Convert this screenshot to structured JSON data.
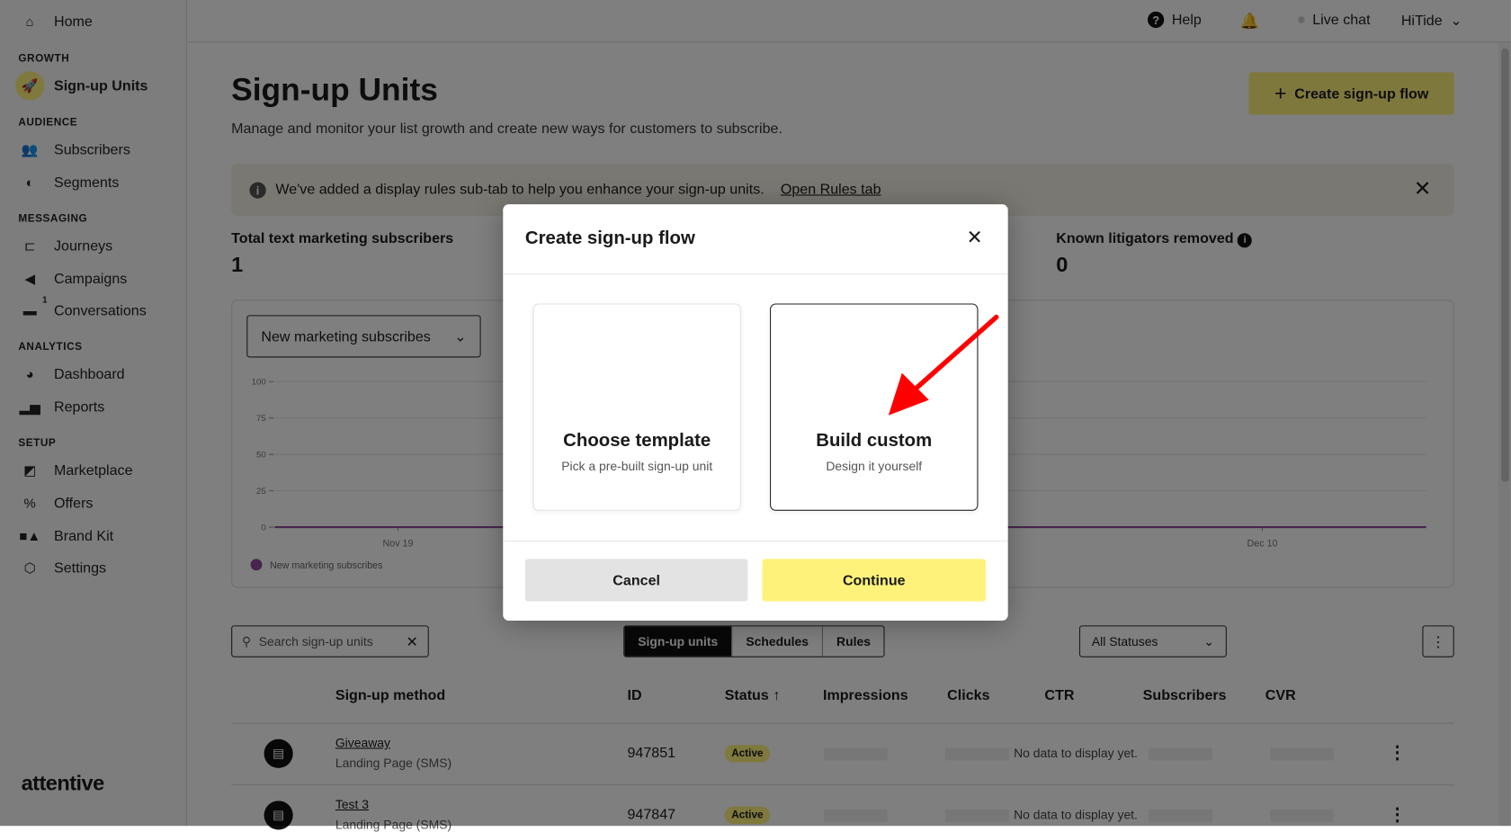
{
  "sidebar": {
    "home": "Home",
    "sections": [
      {
        "title": "GROWTH",
        "items": [
          {
            "label": "Sign-up Units",
            "icon": "rocket-icon",
            "active": true
          }
        ]
      },
      {
        "title": "AUDIENCE",
        "items": [
          {
            "label": "Subscribers",
            "icon": "users-icon"
          },
          {
            "label": "Segments",
            "icon": "segments-icon"
          }
        ]
      },
      {
        "title": "MESSAGING",
        "items": [
          {
            "label": "Journeys",
            "icon": "journeys-icon"
          },
          {
            "label": "Campaigns",
            "icon": "megaphone-icon"
          },
          {
            "label": "Conversations",
            "icon": "chat-icon",
            "badge": "1"
          }
        ]
      },
      {
        "title": "ANALYTICS",
        "items": [
          {
            "label": "Dashboard",
            "icon": "pie-chart-icon"
          },
          {
            "label": "Reports",
            "icon": "bar-chart-icon"
          }
        ]
      },
      {
        "title": "SETUP",
        "items": [
          {
            "label": "Marketplace",
            "icon": "marketplace-icon"
          },
          {
            "label": "Offers",
            "icon": "percent-icon"
          },
          {
            "label": "Brand Kit",
            "icon": "shapes-icon"
          },
          {
            "label": "Settings",
            "icon": "gear-icon"
          }
        ]
      }
    ],
    "logo": "attentive"
  },
  "header": {
    "help": "Help",
    "live_chat": "Live chat",
    "account": "HiTide"
  },
  "page": {
    "title": "Sign-up Units",
    "subtitle": "Manage and monitor your list growth and create new ways for customers to subscribe.",
    "create_button": "Create sign-up flow",
    "banner": {
      "text": "We've added a display rules sub-tab to help you enhance your sign-up units.",
      "link": "Open Rules tab"
    },
    "stats": [
      {
        "label": "Total text marketing subscribers",
        "value": "1"
      },
      {
        "label": "Known litigators removed",
        "value": "0"
      }
    ],
    "metric_select": "New marketing subscribes"
  },
  "chart_data": {
    "type": "line",
    "y_ticks": [
      "0",
      "25",
      "50",
      "75",
      "100"
    ],
    "ylim": [
      0,
      100
    ],
    "x_ticks": [
      "Nov 19",
      "Dec 10"
    ],
    "series": [
      {
        "name": "New marketing subscribes",
        "values": [
          0,
          0,
          0,
          0,
          0,
          0,
          0,
          0,
          0,
          0,
          0,
          0,
          0,
          0,
          0,
          0,
          0,
          0,
          0,
          0,
          0,
          0,
          0,
          0,
          0,
          0,
          0,
          0,
          0,
          0
        ],
        "color": "#8e4b9c"
      }
    ],
    "grid": true,
    "legend": "bottom-left"
  },
  "toolbar": {
    "search_placeholder": "Search sign-up units",
    "tabs": [
      "Sign-up units",
      "Schedules",
      "Rules"
    ],
    "active_tab": "Sign-up units",
    "status_filter": "All Statuses"
  },
  "table": {
    "columns": [
      "Sign-up method",
      "ID",
      "Status",
      "Impressions",
      "Clicks",
      "CTR",
      "Subscribers",
      "CVR"
    ],
    "sorted_column": "Status",
    "rows": [
      {
        "name": "Giveaway",
        "type": "Landing Page (SMS)",
        "id": "947851",
        "status": "Active",
        "note": "No data to display yet."
      },
      {
        "name": "Test 3",
        "type": "Landing Page (SMS)",
        "id": "947847",
        "status": "Active",
        "note": "No data to display yet."
      }
    ]
  },
  "modal": {
    "title": "Create sign-up flow",
    "options": [
      {
        "title": "Choose template",
        "desc": "Pick a pre-built sign-up unit"
      },
      {
        "title": "Build custom",
        "desc": "Design it yourself",
        "selected": true
      }
    ],
    "cancel": "Cancel",
    "continue": "Continue"
  },
  "colors": {
    "accent": "#fef17a",
    "annotation_arrow": "#ff0000",
    "series": "#8e4b9c"
  }
}
